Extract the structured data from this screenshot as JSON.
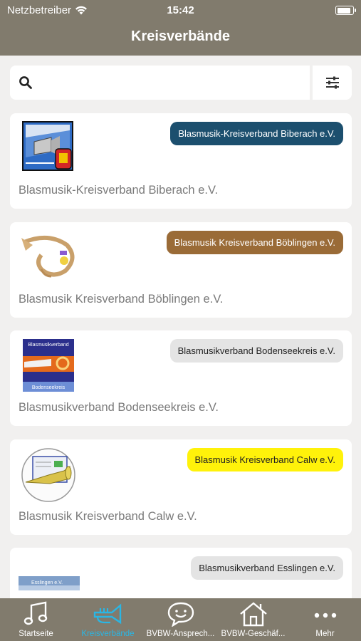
{
  "status_bar": {
    "carrier": "Netzbetreiber",
    "time": "15:42",
    "battery_level": 0.9
  },
  "header": {
    "title": "Kreisverbände"
  },
  "search": {
    "value": "",
    "placeholder": ""
  },
  "cards": [
    {
      "badge": "Blasmusik-Kreisverband Biberach e.V.",
      "badge_bg": "#1c4f6e",
      "badge_fg": "#ffffff",
      "title": "Blasmusik-Kreisverband Biberach e.V."
    },
    {
      "badge": "Blasmusik Kreisverband Böblingen e.V.",
      "badge_bg": "#9a6b37",
      "badge_fg": "#ffffff",
      "title": "Blasmusik Kreisverband Böblingen e.V."
    },
    {
      "badge": "Blasmusikverband Bodenseekreis e.V.",
      "badge_bg": "#e4e4e4",
      "badge_fg": "#222222",
      "title": "Blasmusikverband Bodenseekreis e.V.",
      "logo_text_top": "Blasmusikverband",
      "logo_text_bottom": "Bodenseekreis"
    },
    {
      "badge": "Blasmusik Kreisverband Calw e.V.",
      "badge_bg": "#fff20a",
      "badge_fg": "#222222",
      "title": "Blasmusik Kreisverband Calw e.V."
    },
    {
      "badge": "Blasmusikverband Esslingen e.V.",
      "badge_bg": "#e4e4e4",
      "badge_fg": "#222222",
      "title": "",
      "logo_text": "Esslingen e.V."
    }
  ],
  "tabs": [
    {
      "label": "Startseite",
      "icon": "music-note-icon",
      "active": false
    },
    {
      "label": "Kreisverbände",
      "icon": "trumpet-icon",
      "active": true
    },
    {
      "label": "BVBW-Ansprech...",
      "icon": "chat-bubble-icon",
      "active": false
    },
    {
      "label": "BVBW-Geschäf...",
      "icon": "house-icon",
      "active": false
    },
    {
      "label": "Mehr",
      "icon": "more-dots-icon",
      "active": false
    }
  ],
  "colors": {
    "bar_bg": "#817b6d",
    "accent": "#2ab6e4",
    "page_bg": "#f1f0ef"
  }
}
